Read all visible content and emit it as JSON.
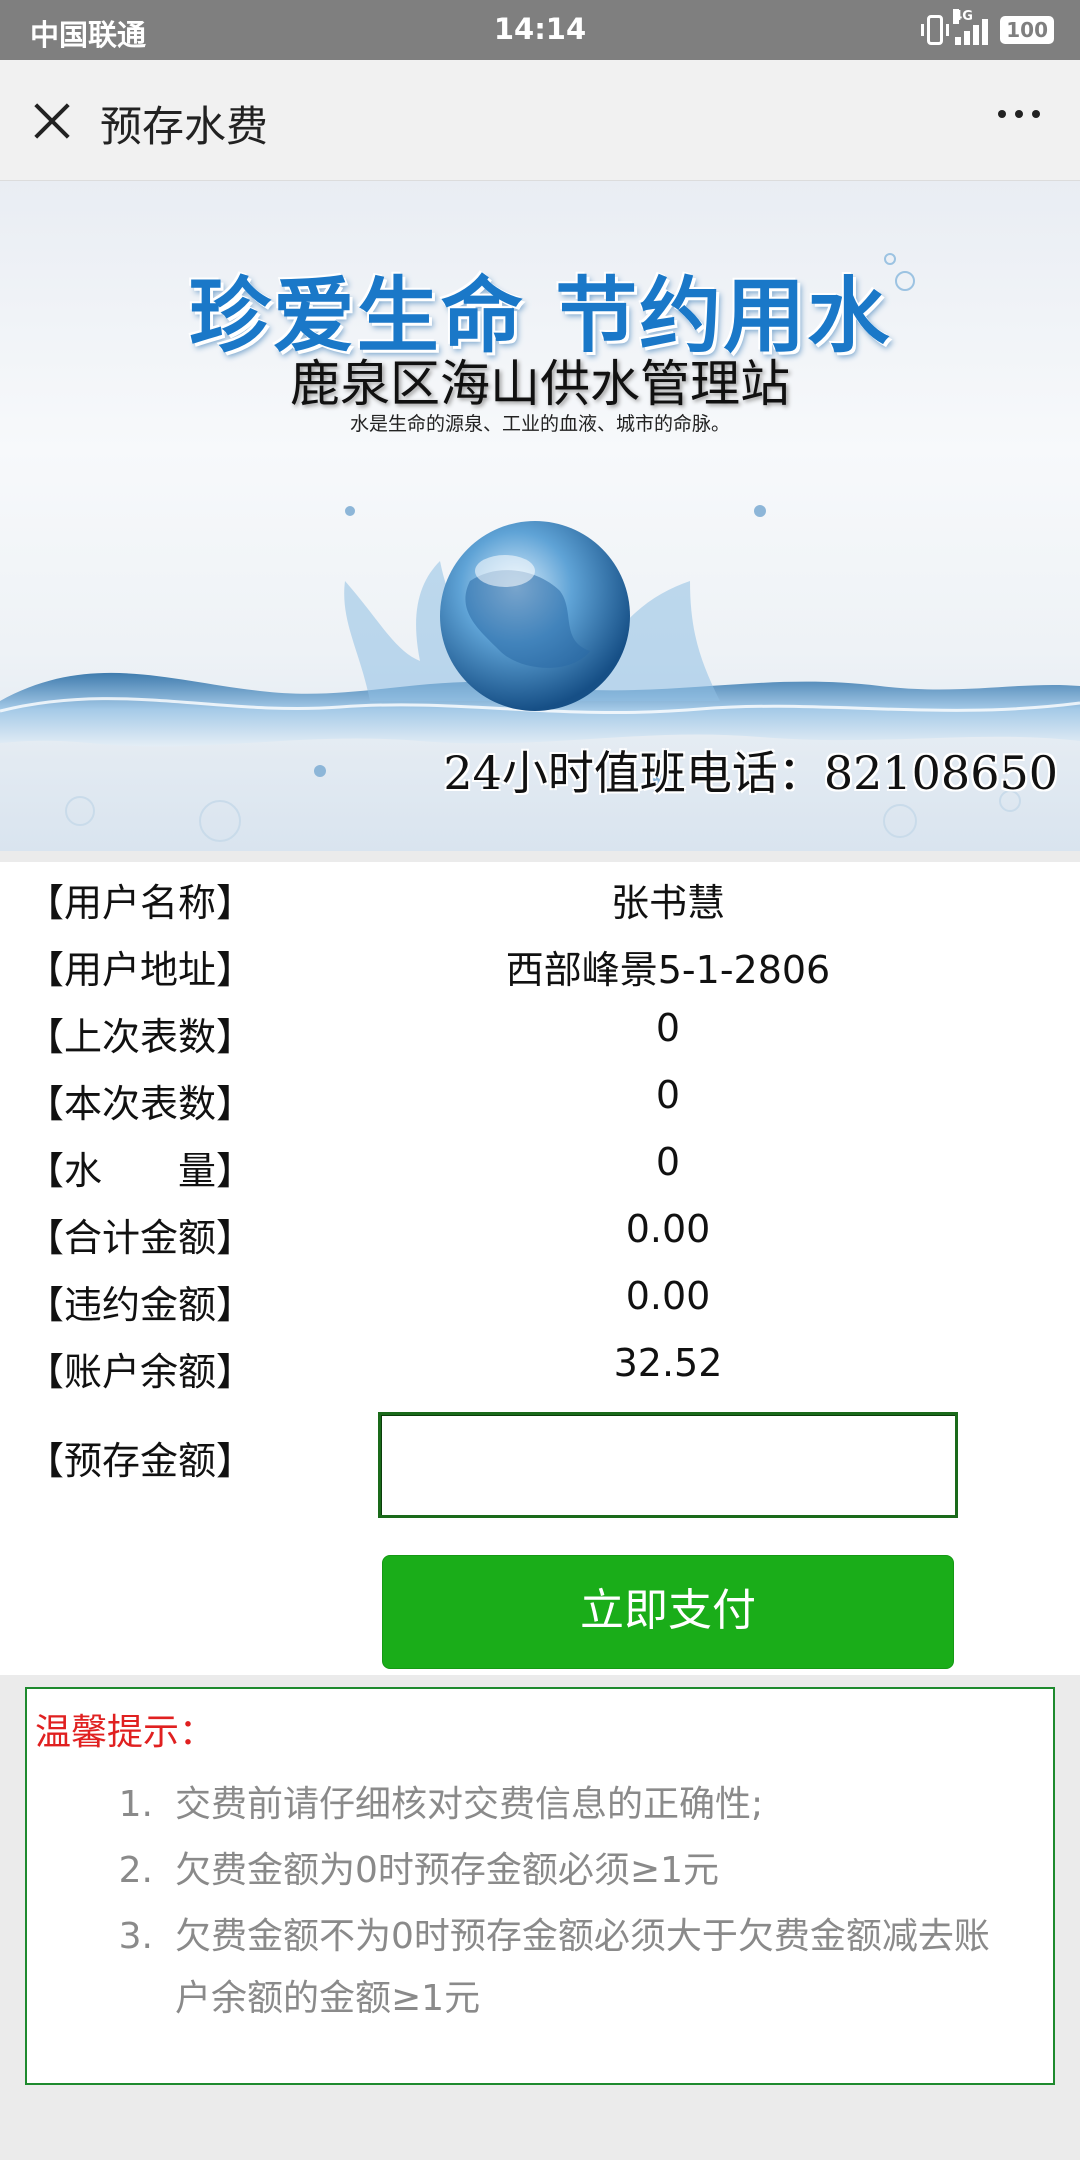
{
  "status_bar": {
    "carrier": "中国联通",
    "time": "14:14",
    "network": "4G",
    "battery": "100"
  },
  "header": {
    "title": "预存水费"
  },
  "banner": {
    "slogan": "珍爱生命 节约用水",
    "station": "鹿泉区海山供水管理站",
    "motto": "水是生命的源泉、工业的血液、城市的命脉。",
    "hotline": "24小时值班电话：82108650"
  },
  "info": {
    "rows": [
      {
        "label": "【用户名称】",
        "value": "张书慧"
      },
      {
        "label": "【用户地址】",
        "value": "西部峰景5-1-2806"
      },
      {
        "label": "【上次表数】",
        "value": "0"
      },
      {
        "label": "【本次表数】",
        "value": "0"
      },
      {
        "label": "【水　　量】",
        "value": "0"
      },
      {
        "label": "【合计金额】",
        "value": "0.00"
      },
      {
        "label": "【违约金额】",
        "value": "0.00"
      },
      {
        "label": "【账户余额】",
        "value": "32.52"
      }
    ],
    "deposit_label": "【预存金额】",
    "deposit_value": "",
    "pay_button": "立即支付"
  },
  "tips": {
    "title": "温馨提示：",
    "items": [
      {
        "num": "1.",
        "text": "交费前请仔细核对交费信息的正确性;"
      },
      {
        "num": "2.",
        "text": "欠费金额为0时预存金额必须≥1元"
      },
      {
        "num": "3.",
        "text": "欠费金额不为0时预存金额必须大于欠费金额减去账户余额的金额≥1元"
      }
    ]
  },
  "colors": {
    "pay_button": "#1aad19",
    "tips_title": "#e02020",
    "tips_border": "#1e8a2e",
    "slogan": "#1a78c8"
  }
}
